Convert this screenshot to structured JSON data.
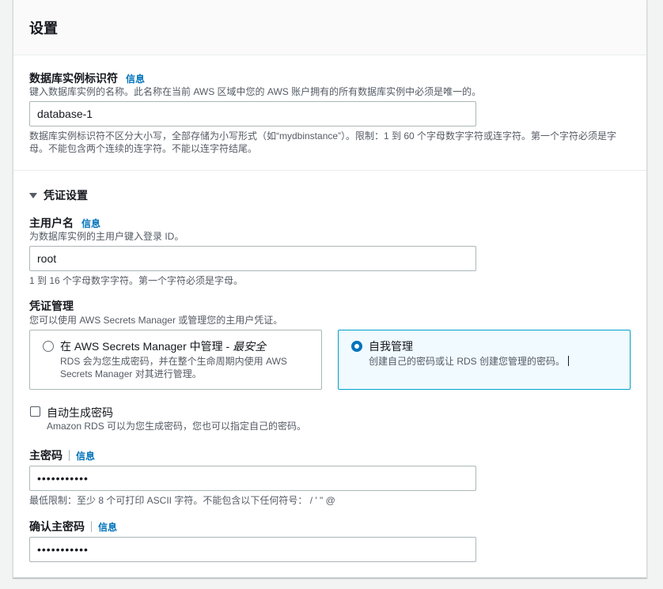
{
  "section": {
    "title": "设置"
  },
  "db_identifier": {
    "label": "数据库实例标识符",
    "info": "信息",
    "description": "键入数据库实例的名称。此名称在当前 AWS 区域中您的 AWS 账户拥有的所有数据库实例中必须是唯一的。",
    "value": "database-1",
    "constraint": "数据库实例标识符不区分大小写，全部存储为小写形式（如“mydbinstance”）。限制：1 到 60 个字母数字字符或连字符。第一个字符必须是字母。不能包含两个连续的连字符。不能以连字符结尾。"
  },
  "credentials": {
    "toggle_label": "凭证设置",
    "master_username": {
      "label": "主用户名",
      "info": "信息",
      "description": "为数据库实例的主用户键入登录 ID。",
      "value": "root",
      "constraint": "1 到 16 个字母数字字符。第一个字符必须是字母。"
    },
    "management": {
      "label": "凭证管理",
      "description": "您可以使用 AWS Secrets Manager 或管理您的主用户凭证。",
      "options": [
        {
          "title": "在 AWS Secrets Manager 中管理 - ",
          "title_emphasis": "最安全",
          "description": "RDS 会为您生成密码，并在整个生命周期内使用 AWS Secrets Manager 对其进行管理。",
          "selected": false
        },
        {
          "title": "自我管理",
          "description": "创建自己的密码或让 RDS 创建您管理的密码。",
          "selected": true
        }
      ]
    },
    "auto_generate": {
      "label": "自动生成密码",
      "description": "Amazon RDS 可以为您生成密码，您也可以指定自己的密码。",
      "checked": false
    },
    "master_password": {
      "label": "主密码",
      "info": "信息",
      "value": "•••••••••••",
      "constraint": "最低限制：至少 8 个可打印 ASCII 字符。不能包含以下任何符号： / ' \" @"
    },
    "confirm_password": {
      "label": "确认主密码",
      "info": "信息",
      "value": "•••••••••••"
    }
  },
  "colors": {
    "link": "#0073bb",
    "selected_border": "#00a1c9",
    "selected_bg": "#f1faff"
  }
}
